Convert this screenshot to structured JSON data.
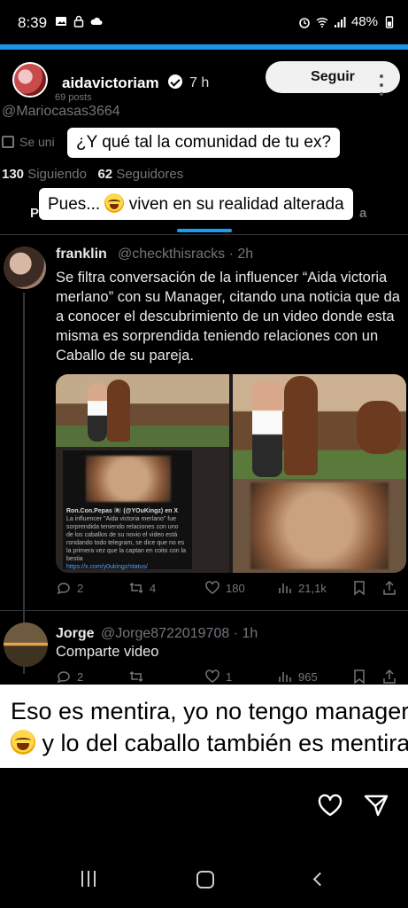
{
  "status_bar": {
    "time": "8:39",
    "battery": "48%"
  },
  "story": {
    "username": "aidavictoriam",
    "time_ago": "7 h",
    "posts_count": "69 posts",
    "follow_label": "Seguir"
  },
  "profile": {
    "handle": "@Mariocasas3664",
    "joined_prefix": "Se uni",
    "following_count": "130",
    "following_label": "Siguiendo",
    "followers_count": "62",
    "followers_label": "Seguidores",
    "tab_left_letter": "P",
    "tab_right_letter": "a"
  },
  "stickers": {
    "question": "¿Y qué tal la comunidad de tu ex?",
    "answer_prefix": "Pues...",
    "answer_suffix": "viven en su realidad alterada"
  },
  "tweets": [
    {
      "name": "franklin",
      "handle": "@checkthisracks",
      "time": "· 2h",
      "text": "Se filtra conversación de la influencer “Aida victoria merlano” con su Manager, citando una noticia que da a conocer el descubrimiento de un video donde esta misma es sorprendida teniendo relaciones con un Caballo de su pareja.",
      "media_card": {
        "title": "Ron.Con.Pepas 🏴‍☠️ (@YOuKingz) en X",
        "body": "La influencer \"Aida victoria merlano\" fue sorprendida teniendo relaciones con uno de los caballos de su novio el video está rondando todo telegram, se dice que no es la primera vez que la captan en coito con la bestia",
        "link": "https://x.com/y0ukingz/status/"
      },
      "replies": "2",
      "retweets": "4",
      "likes": "180",
      "views": "21,1k"
    },
    {
      "name": "Jorge",
      "handle": "@Jorge8722019708",
      "time": "· 1h",
      "text": "Comparte video",
      "replies": "2",
      "retweets": "",
      "likes": "1",
      "views": "965"
    }
  ],
  "caption": {
    "line1": "Eso es mentira, yo no tengo manager",
    "line2": "y lo del caballo también es mentira."
  }
}
